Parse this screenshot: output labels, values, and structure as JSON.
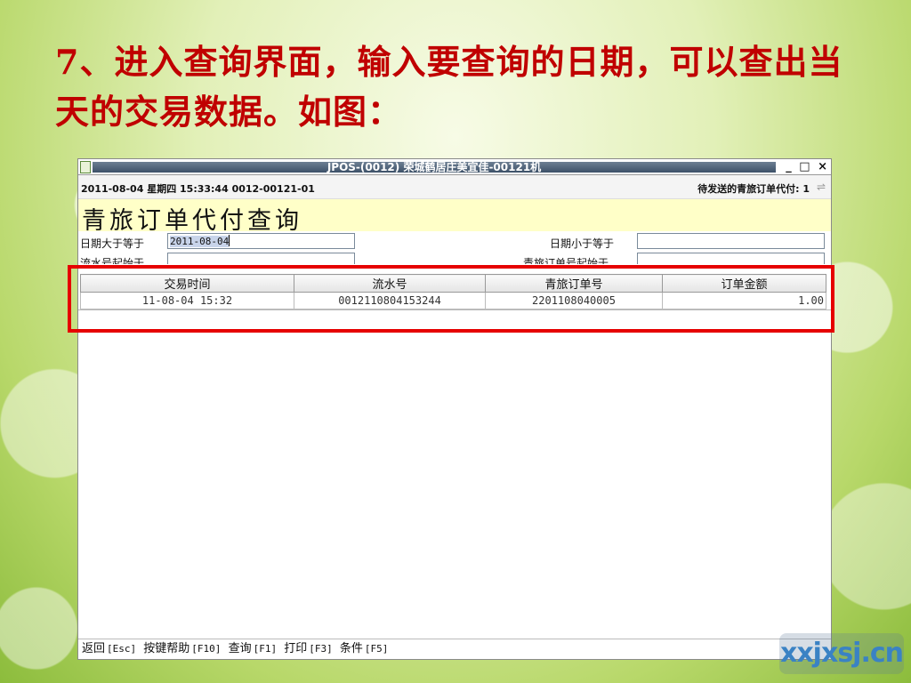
{
  "slide": {
    "title": "7、进入查询界面，输入要查询的日期，可以查出当天的交易数据。如图："
  },
  "window": {
    "title": "JPOS-(0012) 荣城鹤居庄美宜佳-00121机",
    "controls": [
      "_",
      "□",
      "×"
    ]
  },
  "status": {
    "left": "2011-08-04 星期四 15:33:44 0012-00121-01",
    "right": "待发送的青旅订单代付: 1"
  },
  "page": {
    "heading": "青旅订单代付查询"
  },
  "form": {
    "date_from_label": "日期大于等于",
    "date_from_value": "2011-08-04",
    "date_to_label": "日期小于等于",
    "date_to_value": "",
    "serial_start_label": "流水号起始于",
    "order_start_label": "青旅订单号起始于"
  },
  "grid": {
    "columns": [
      "交易时间",
      "流水号",
      "青旅订单号",
      "订单金额"
    ],
    "rows": [
      [
        "11-08-04 15:32",
        "0012110804153244",
        "2201108040005",
        "1.00"
      ]
    ]
  },
  "footer": {
    "items": [
      {
        "label": "返回",
        "key": "[Esc]"
      },
      {
        "label": "按键帮助",
        "key": "[F10]"
      },
      {
        "label": "查询",
        "key": "[F1]"
      },
      {
        "label": "打印",
        "key": "[F3]"
      },
      {
        "label": "条件",
        "key": "[F5]"
      }
    ]
  },
  "watermark": {
    "text": "xxjxsj.cn"
  },
  "colors": {
    "title_red": "#c00000",
    "highlight_red": "#e60000",
    "header_band": "#ffffc8"
  }
}
